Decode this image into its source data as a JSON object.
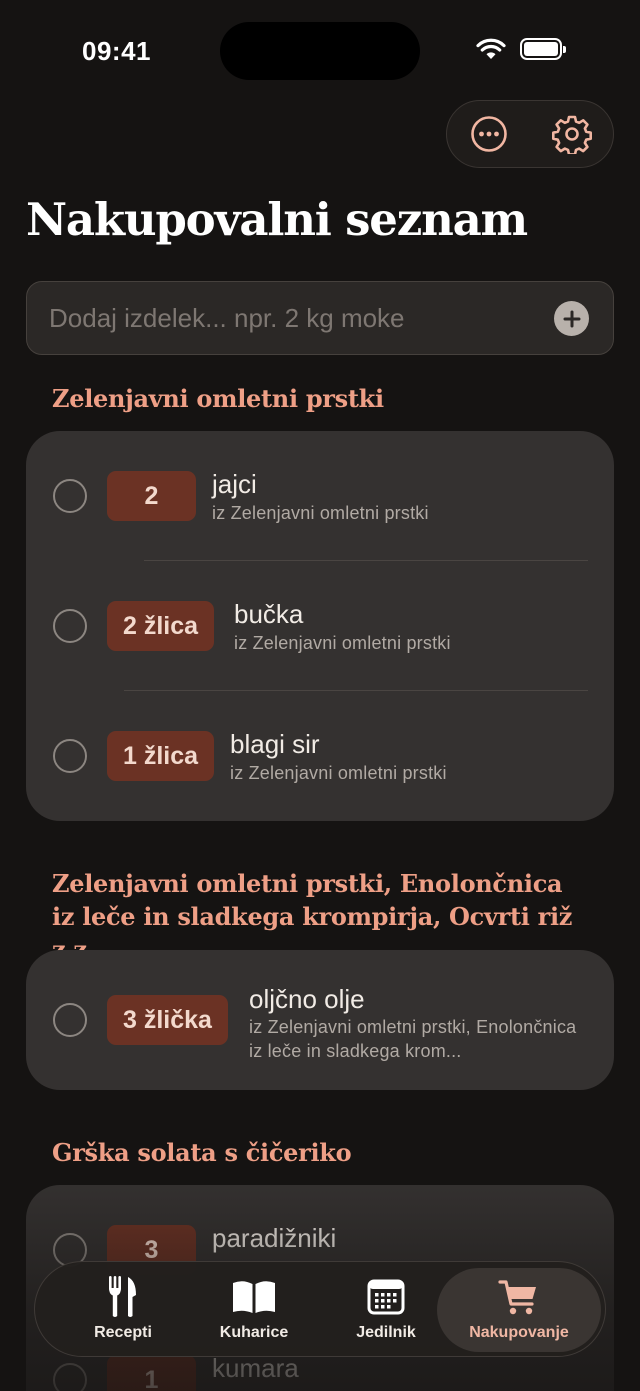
{
  "status_bar": {
    "time": "09:41"
  },
  "toolbar": {
    "more_icon": "ellipsis-circle-icon",
    "settings_icon": "gear-icon"
  },
  "page_title": "Nakupovalni seznam",
  "add_item": {
    "placeholder": "Dodaj izdelek... npr. 2 kg moke",
    "icon": "plus-circle-icon"
  },
  "sections": [
    {
      "title": "Zelenjavni omletni prstki",
      "items": [
        {
          "qty": "2",
          "name": "jajci",
          "source": "iz Zelenjavni omletni prstki"
        },
        {
          "qty": "2 žlica",
          "name": "bučka",
          "source": "iz Zelenjavni omletni prstki"
        },
        {
          "qty": "1 žlica",
          "name": "blagi sir",
          "source": "iz Zelenjavni omletni prstki"
        }
      ]
    },
    {
      "title": "Zelenjavni omletni prstki, Enolončnica iz leče in sladkega krompirja, Ocvrti riž z z...",
      "items": [
        {
          "qty": "3 žlička",
          "name": "oljčno olje",
          "source": "iz Zelenjavni omletni prstki, Enolončnica iz leče in sladkega krom..."
        }
      ]
    },
    {
      "title": "Grška solata s čičeriko",
      "items": [
        {
          "qty": "3",
          "name": "paradižniki",
          "source": ""
        },
        {
          "qty": "1",
          "name": "kumara",
          "source": ""
        }
      ]
    }
  ],
  "tabbar": [
    {
      "label": "Recepti",
      "icon": "fork-knife-icon",
      "active": false
    },
    {
      "label": "Kuharice",
      "icon": "open-book-icon",
      "active": false
    },
    {
      "label": "Jedilnik",
      "icon": "calendar-icon",
      "active": false
    },
    {
      "label": "Nakupovanje",
      "icon": "shopping-cart-icon",
      "active": true
    }
  ],
  "colors": {
    "accent": "#ee9f86",
    "qty_badge": "#6b3224",
    "background": "#151312",
    "card": "#343130"
  }
}
